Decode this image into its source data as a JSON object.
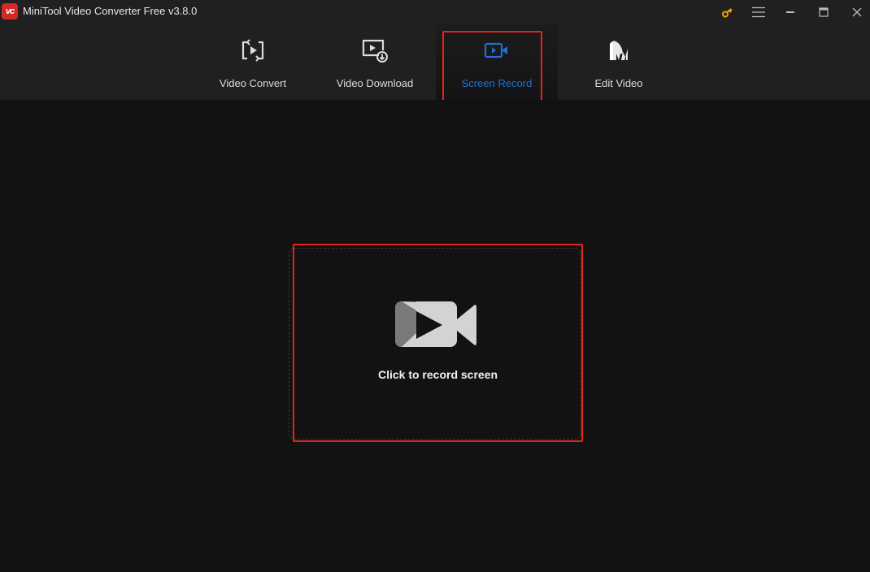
{
  "titlebar": {
    "logo_text": "vc",
    "title": "MiniTool Video Converter Free v3.8.0",
    "controls": [
      "key-icon",
      "menu-icon",
      "minimize-icon",
      "maximize-icon",
      "close-icon"
    ],
    "key_color": "#f0a30a"
  },
  "nav": {
    "tabs": [
      {
        "label": "Video Convert",
        "icon": "convert-icon",
        "active": false
      },
      {
        "label": "Video Download",
        "icon": "download-icon",
        "active": false
      },
      {
        "label": "Screen Record",
        "icon": "screen-record-icon",
        "active": true
      },
      {
        "label": "Edit Video",
        "icon": "edit-video-icon",
        "active": false
      }
    ],
    "active_color": "#1f70d6"
  },
  "main": {
    "record_label": "Click to record screen",
    "highlight_color": "#e5221c"
  }
}
